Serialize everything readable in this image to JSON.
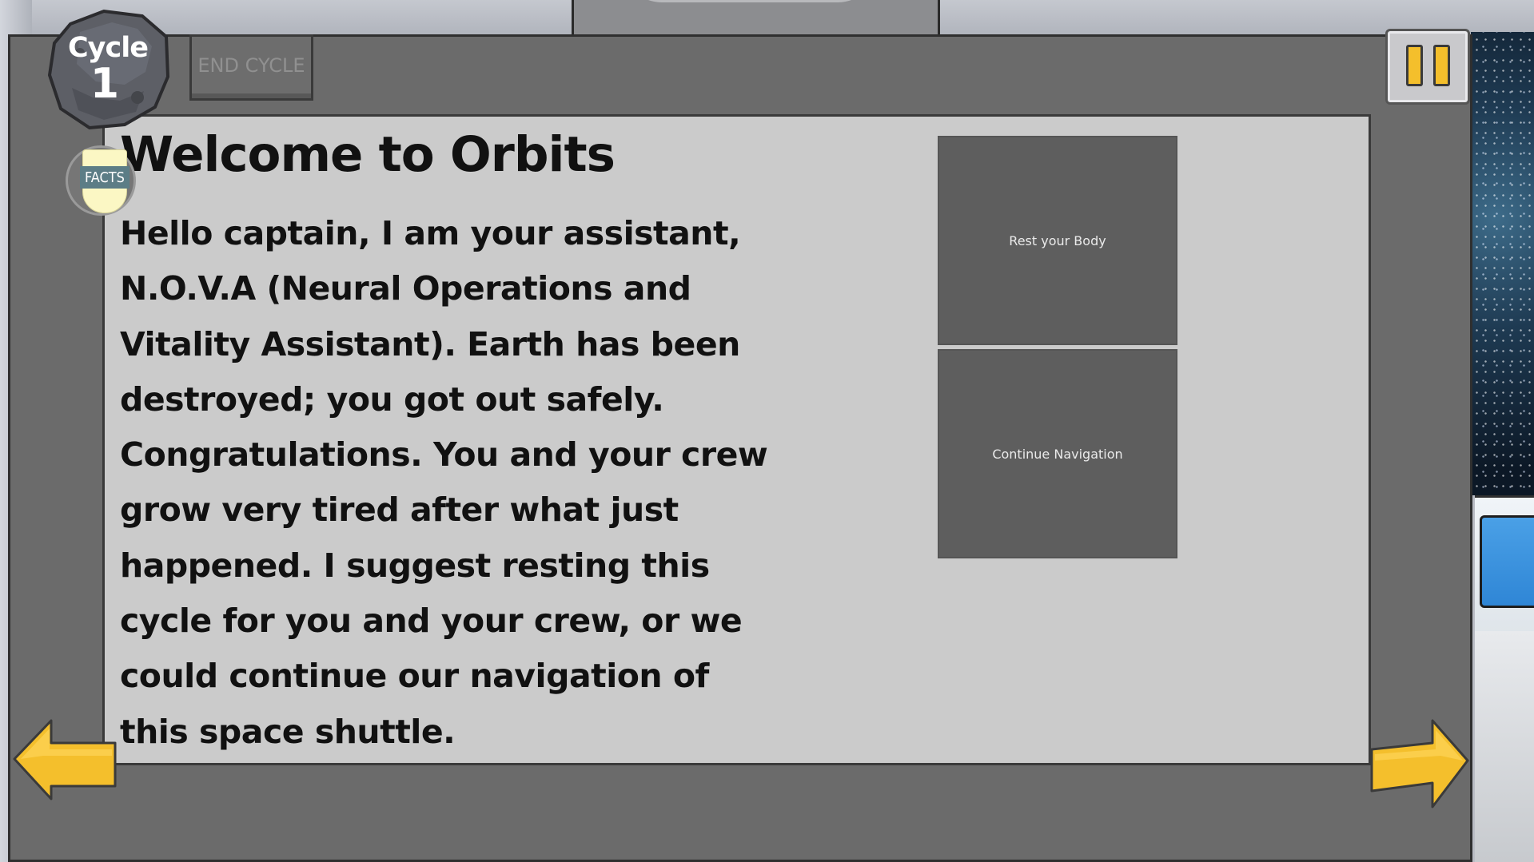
{
  "cycle": {
    "label": "Cycle",
    "number": "1"
  },
  "toolbar": {
    "end_cycle_label": "END CYCLE"
  },
  "facts": {
    "label": "FACTS"
  },
  "dialog": {
    "title": "Welcome to Orbits",
    "body": "Hello captain, I am your assistant, N.O.V.A (Neural Operations and Vitality Assistant). Earth has been destroyed; you got out safely. Congratulations. You and your crew grow very tired after what just happened. I suggest resting this cycle for you and your crew, or we could continue our navigation of this space shuttle."
  },
  "choices": [
    {
      "label": "Rest your Body"
    },
    {
      "label": "Continue Navigation"
    }
  ],
  "colors": {
    "frame": "#6b6b6b",
    "panel": "#cbcbcb",
    "choice_bg": "#5e5e5e",
    "arrow": "#f4bf2c",
    "facts_band": "#5c7d86"
  },
  "icons": {
    "pause": "pause-icon",
    "prev": "arrow-left-icon",
    "next": "arrow-right-icon",
    "cycle": "asteroid-icon",
    "facts": "shield-icon"
  }
}
